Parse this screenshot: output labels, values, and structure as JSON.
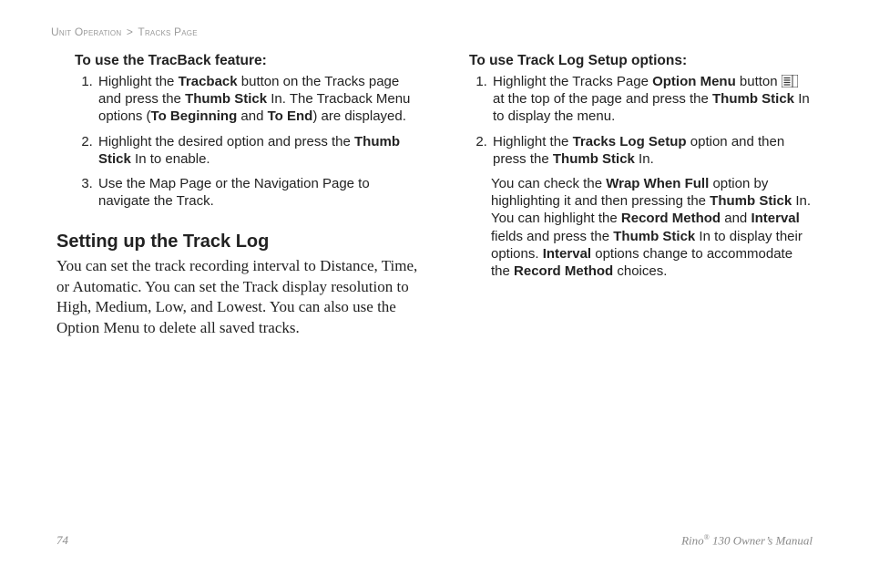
{
  "breadcrumb": {
    "a": "Unit Operation",
    "sep": ">",
    "b": "Tracks Page"
  },
  "left": {
    "subhead": "To use the TracBack feature:",
    "items": [
      {
        "pre": "Highlight the ",
        "b1": "Tracback",
        "mid1": " button on the Tracks page and press the ",
        "b2": "Thumb Stick",
        "mid2": " In. The Tracback Menu options (",
        "b3": "To Beginning",
        "and": " and ",
        "b4": "To End",
        "post": ") are displayed."
      },
      {
        "pre": "Highlight the desired option and press the ",
        "b1": "Thumb Stick",
        "post": " In to enable."
      },
      {
        "pre": "Use the Map Page or the Navigation Page to navigate the Track."
      }
    ],
    "heading": "Setting up the Track Log",
    "body": "You can set the track recording interval to Distance, Time, or Automatic. You can set the Track display resolution to High, Medium, Low, and Lowest. You can also use the Option Menu to delete all saved tracks."
  },
  "right": {
    "subhead": "To use Track Log Setup options:",
    "items": [
      {
        "pre": "Highlight the Tracks Page ",
        "b1": "Option Menu",
        "mid1": " button ",
        "iconAfter": " at the top of the page and press the ",
        "b2": "Thumb Stick",
        "post": " In to display the menu."
      },
      {
        "pre": "Highlight the ",
        "b1": "Tracks Log Setup",
        "mid1": " option and then press the ",
        "b2": "Thumb Stick",
        "post": " In."
      }
    ],
    "after": {
      "t1": "You can check the ",
      "b1": "Wrap When Full",
      "t2": " option by highlighting it and then pressing the ",
      "b2": "Thumb Stick",
      "t3": " In. You can highlight the ",
      "b3": "Record Method",
      "t4": " and ",
      "b4": "Interval",
      "t5": " fields and press the ",
      "b5": "Thumb Stick",
      "t6": " In to display their options. ",
      "b6": "Interval",
      "t7": " options change to accommodate the ",
      "b7": "Record Method",
      "t8": " choices."
    }
  },
  "footer": {
    "page": "74",
    "product_pre": "Rino",
    "product_sup": "®",
    "product_post": " 130 Owner’s Manual"
  }
}
